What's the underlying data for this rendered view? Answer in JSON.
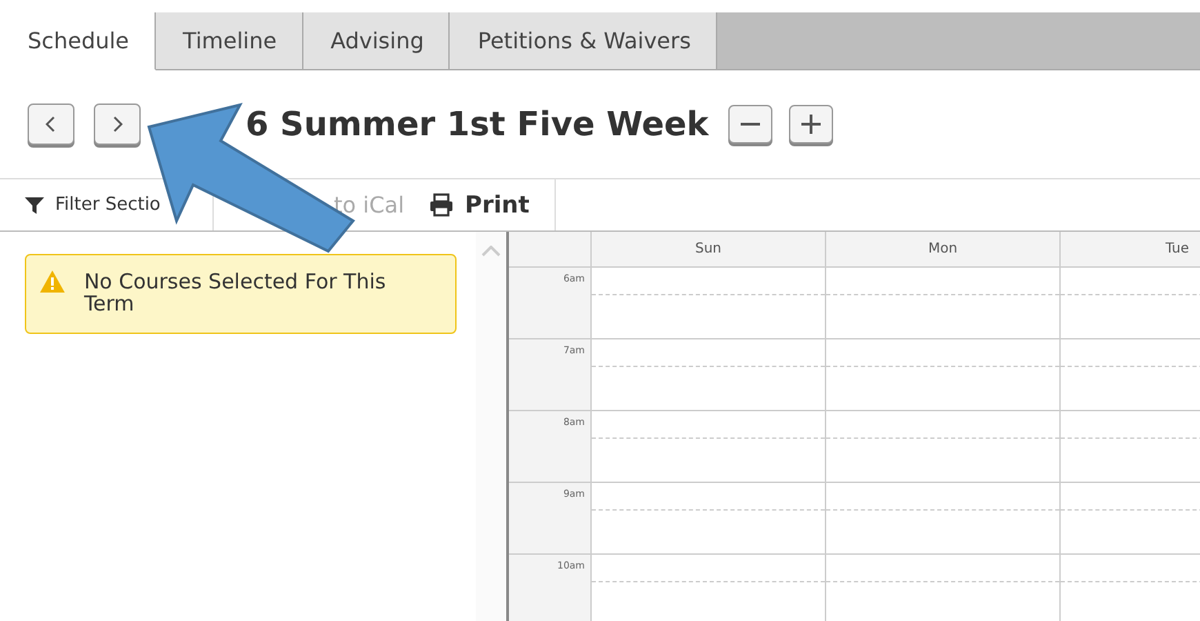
{
  "tabs": [
    {
      "label": "Schedule",
      "selected": true
    },
    {
      "label": "Timeline",
      "selected": false
    },
    {
      "label": "Advising",
      "selected": false
    },
    {
      "label": "Petitions & Waivers",
      "selected": false
    }
  ],
  "term_title": "6 Summer 1st Five Week",
  "toolbar": [
    {
      "kind": "filter",
      "label": "Filter Sectio",
      "muted": false
    },
    {
      "kind": "ical",
      "label": "to iCal",
      "muted": true
    },
    {
      "kind": "print",
      "label": "Print",
      "muted": false
    }
  ],
  "alert": {
    "text": "No Courses Selected For This Term"
  },
  "calendar": {
    "days": [
      "Sun",
      "Mon",
      "Tue"
    ],
    "hours": [
      "6am",
      "7am",
      "8am",
      "9am",
      "10am"
    ]
  }
}
